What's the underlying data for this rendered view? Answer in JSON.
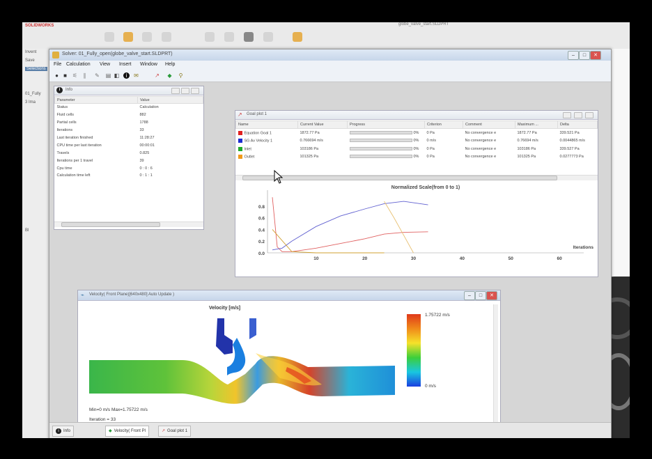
{
  "background_app": {
    "logo": "SOLIDWORKS",
    "title": "globe_valve_start.SLDPRT",
    "tree_items": [
      "Invent",
      "Save",
      "Selections",
      "01_Fully",
      "3 Ima",
      "Bl"
    ]
  },
  "solver": {
    "title": "Solver: 01_Fully_open(globe_valve_start.SLDPRT)",
    "menu": [
      "File",
      "Calculation",
      "View",
      "Insert",
      "Window",
      "Help"
    ]
  },
  "info_panel": {
    "title": "Info",
    "columns": [
      "Parameter",
      "Value"
    ],
    "rows": [
      [
        "Status",
        "Calculation"
      ],
      [
        "Fluid cells",
        "882"
      ],
      [
        "Partial cells",
        "1788"
      ],
      [
        "Iterations",
        "33"
      ],
      [
        "Last iteration finished",
        "11:28:27"
      ],
      [
        "CPU time per last iteration",
        "00:00:01"
      ],
      [
        "Travels",
        "0.825"
      ],
      [
        "Iterations per 1 travel",
        "39"
      ],
      [
        "Cpu time",
        "0 : 0 : 6"
      ],
      [
        "Calculation time left",
        "0 : 1 : 1"
      ]
    ]
  },
  "goal_panel": {
    "title": "Goal plot 1",
    "columns": [
      "Name",
      "Current Value",
      "Progress",
      "Criterion",
      "Comment",
      "Maximum ...",
      "Delta"
    ],
    "rows": [
      {
        "color": "#e02020",
        "name": "Equation Goal 1",
        "current": "1872.77 Pa",
        "progress": 0,
        "progress_label": "0%",
        "criterion": "0 Pa",
        "comment": "No convergence e",
        "max": "1872.77 Pa",
        "delta": "339.521 Pa"
      },
      {
        "color": "#1a2bd0",
        "name": "SG Av Velocity 1",
        "current": "0.766694 m/s",
        "progress": 0,
        "progress_label": "0%",
        "criterion": "0 m/s",
        "comment": "No convergence e",
        "max": "0.76694 m/s",
        "delta": "0.0044865 m/s"
      },
      {
        "color": "#1faa2a",
        "name": "Inlet",
        "current": "103186 Pa",
        "progress": 0,
        "progress_label": "0%",
        "criterion": "0 Pa",
        "comment": "No convergence e",
        "max": "103186 Pa",
        "delta": "339.527 Pa"
      },
      {
        "color": "#f09a1a",
        "name": "Outlet",
        "current": "101325 Pa",
        "progress": 0,
        "progress_label": "0%",
        "criterion": "0 Pa",
        "comment": "No convergence e",
        "max": "101325 Pa",
        "delta": "0.0277773 Pa"
      }
    ]
  },
  "chart_data": {
    "type": "line",
    "title": "Normalized Scale(from 0 to 1)",
    "xlabel": "Iterations",
    "ylabel": "",
    "xlim": [
      0,
      65
    ],
    "ylim": [
      0,
      1
    ],
    "x_ticks": [
      10,
      20,
      30,
      40,
      50,
      60
    ],
    "y_ticks": [
      "0.0",
      "0.2",
      "0.4",
      "0.6",
      "0.8"
    ],
    "series": [
      {
        "color": "#e06060",
        "x": [
          1,
          2,
          3,
          5,
          10,
          15,
          20,
          24,
          28,
          33
        ],
        "y": [
          0.95,
          0.1,
          0.02,
          0.02,
          0.08,
          0.16,
          0.24,
          0.32,
          0.35,
          0.36
        ]
      },
      {
        "color": "#6060d0",
        "x": [
          1,
          3,
          5,
          10,
          15,
          20,
          24,
          28,
          33
        ],
        "y": [
          0.05,
          0.08,
          0.2,
          0.45,
          0.63,
          0.75,
          0.84,
          0.88,
          0.82
        ]
      },
      {
        "color": "#d0a030",
        "x": [
          1,
          5,
          10,
          15,
          20,
          24
        ],
        "y": [
          0.4,
          0.02,
          0.0,
          0.0,
          0.0,
          0.0
        ]
      },
      {
        "color": "#e8c070",
        "x": [
          24,
          26,
          28,
          30
        ],
        "y": [
          0.88,
          0.6,
          0.3,
          0.0
        ]
      }
    ]
  },
  "velocity_panel": {
    "title": "Velocity( Front Plane)[640x480] Auto Update )",
    "plot_title": "Velocity [m/s]",
    "scale_max": "1.75722 m/s",
    "scale_min": "0 m/s",
    "min_max": "Min=0 m/s   Max=1.75722 m/s",
    "iteration": "Iteration = 33"
  },
  "tabs": [
    "Info",
    "Velocity( Front Pl",
    "Goal plot 1"
  ]
}
